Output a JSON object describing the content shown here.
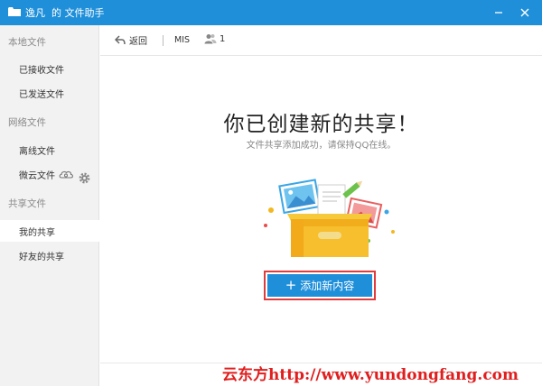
{
  "window": {
    "title": "逸凡  的 文件助手",
    "minimize_label": "–",
    "close_label": "×"
  },
  "sidebar": {
    "sections": [
      {
        "title": "本地文件",
        "items": [
          {
            "label": "已接收文件"
          },
          {
            "label": "已发送文件"
          }
        ]
      },
      {
        "title": "网络文件",
        "items": [
          {
            "label": "离线文件"
          },
          {
            "label": "微云文件"
          }
        ]
      },
      {
        "title": "共享文件",
        "items": [
          {
            "label": "我的共享",
            "active": true
          },
          {
            "label": "好友的共享"
          }
        ]
      }
    ]
  },
  "toolbar": {
    "back_label": "返回",
    "share_name": "MIS",
    "member_count": "1"
  },
  "main": {
    "headline": "你已创建新的共享！",
    "subline": "文件共享添加成功，请保持QQ在线。",
    "add_button_label": "添加新内容",
    "add_button_icon": "+"
  },
  "watermark": "云东方http://www.yundongfang.com",
  "colors": {
    "titlebar": "#1f8fd9",
    "button": "#1f8fd9",
    "highlight_border": "#e23b3b",
    "watermark": "#e11e1e"
  }
}
